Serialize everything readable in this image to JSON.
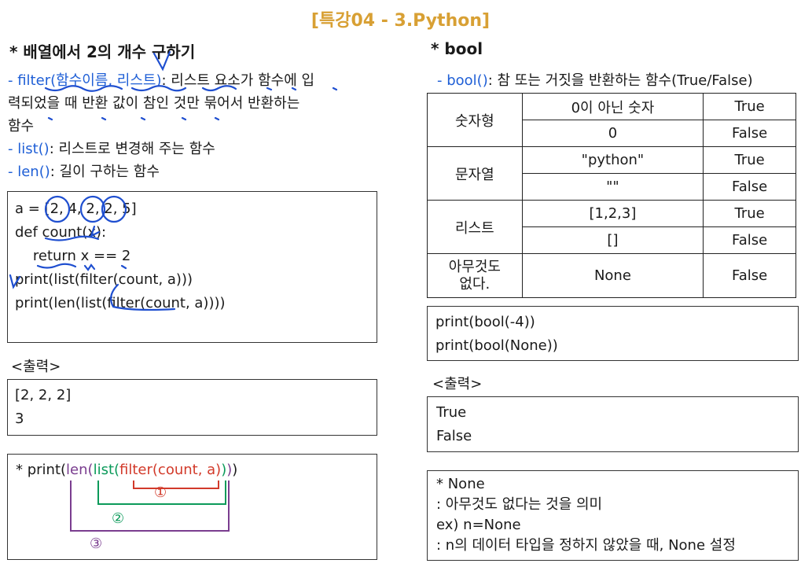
{
  "title": "[특강04 - 3.Python]",
  "left": {
    "heading": "* 배열에서 2의 개수 구하기",
    "defs": [
      {
        "term": "- filter(함수이름, 리스트)",
        "desc": ": 리스트 요소가 함수에 입"
      },
      {
        "cont": "력되었을 때 반환 값이 참인 것만 묶어서 반환하는"
      },
      {
        "cont": "함수"
      },
      {
        "term": "- list()",
        "desc": ": 리스트로 변경해 주는 함수"
      },
      {
        "term": "- len()",
        "desc": ": 길이 구하는 함수"
      }
    ],
    "code": [
      "a = [2, 4, 2, 2, 5]",
      "def count(x):",
      "    return x == 2",
      "",
      "print(list(filter(count, a)))",
      "print(len(list(filter(count, a))))"
    ],
    "output_label": "<출력>",
    "output": [
      "[2, 2, 2]",
      "3"
    ],
    "nested": {
      "prefix": "* print(",
      "len": "len(",
      "list": "list(",
      "filter": "filter(count, a)",
      "close_list": ")",
      "close_len": ")",
      "close_print": ")",
      "n1": "①",
      "n2": "②",
      "n3": "③"
    }
  },
  "right": {
    "heading": "* bool",
    "def_term": "- bool()",
    "def_desc": ": 참 또는 거짓을 반환하는 함수(True/False)",
    "table": [
      {
        "type": "숫자형",
        "rows": [
          [
            "0이 아닌 숫자",
            "True"
          ],
          [
            "0",
            "False"
          ]
        ]
      },
      {
        "type": "문자열",
        "rows": [
          [
            "\"python\"",
            "True"
          ],
          [
            "\"\"",
            "False"
          ]
        ]
      },
      {
        "type": "리스트",
        "rows": [
          [
            "[1,2,3]",
            "True"
          ],
          [
            "[]",
            "False"
          ]
        ]
      },
      {
        "type": "아무것도\n없다.",
        "rows": [
          [
            "None",
            "False"
          ]
        ]
      }
    ],
    "code": [
      "print(bool(-4))",
      "print(bool(None))"
    ],
    "output_label": "<출력>",
    "output": [
      "True",
      "False"
    ],
    "note": [
      "* None",
      ": 아무것도 없다는 것을 의미",
      "ex) n=None",
      ": n의 데이터 타입을 정하지 않았을 때, None 설정"
    ]
  },
  "colors": {
    "title": "#d8a034",
    "term": "#1f5fd6",
    "ink": "#1f4fd0",
    "len": "#7a3d8f",
    "list": "#0b9a5a",
    "filter": "#d23a2a"
  }
}
